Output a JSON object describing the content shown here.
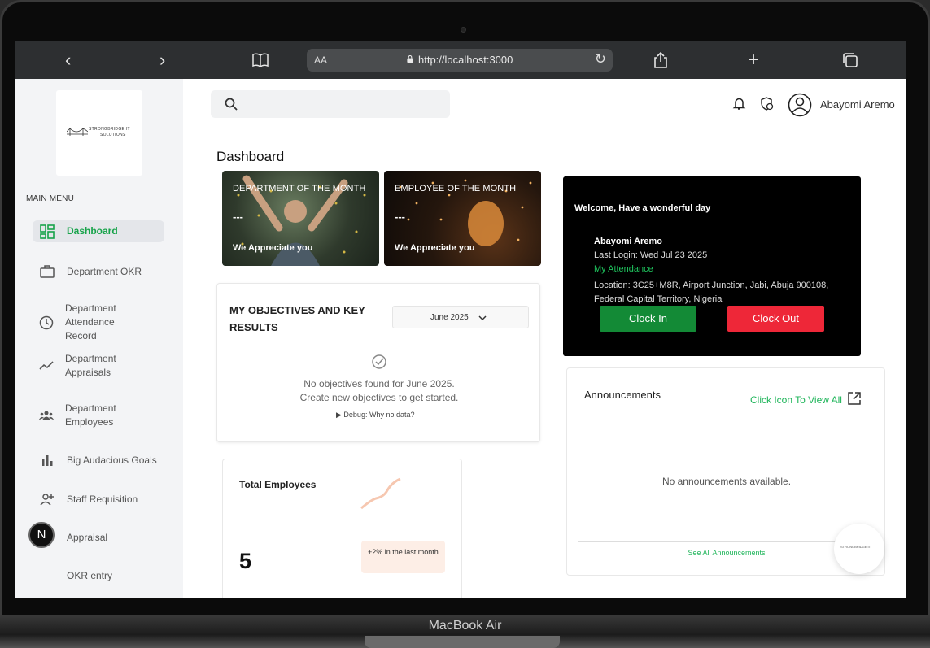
{
  "device": {
    "label": "MacBook Air"
  },
  "browser": {
    "url": "http://localhost:3000",
    "reader_label": "AA"
  },
  "sidebar": {
    "logo_text": "STRONGBRIDGE IT",
    "logo_subtext": "SOLUTIONS",
    "menu_title": "MAIN MENU",
    "items": [
      {
        "label": "Dashboard",
        "icon": "dashboard-icon",
        "active": true
      },
      {
        "label": "Department OKR",
        "icon": "briefcase-icon"
      },
      {
        "label": "Department Attendance Record",
        "icon": "clock-icon"
      },
      {
        "label": "Department Appraisals",
        "icon": "trend-icon"
      },
      {
        "label": "Department Employees",
        "icon": "group-icon"
      },
      {
        "label": "Big Audacious Goals",
        "icon": "bar-chart-icon"
      },
      {
        "label": "Staff Requisition",
        "icon": "person-add-icon"
      },
      {
        "label": "Appraisal",
        "icon": "target-icon"
      },
      {
        "label": "OKR entry",
        "icon": "n-badge-icon"
      }
    ],
    "badge_letter": "N"
  },
  "header": {
    "search_placeholder": "",
    "user_name": "Abayomi Aremo"
  },
  "page": {
    "title": "Dashboard"
  },
  "month_cards": [
    {
      "title": "DEPARTMENT OF THE MONTH",
      "value": "---",
      "subtitle": "We Appreciate you"
    },
    {
      "title": "EMPLOYEE OF THE MONTH",
      "value": "---",
      "subtitle": "We Appreciate you"
    }
  ],
  "objectives": {
    "title": "MY OBJECTIVES AND KEY RESULTS",
    "month_selected": "June 2025",
    "empty_line1": "No objectives found for June 2025.",
    "empty_line2": "Create new objectives to get started.",
    "debug_label": "Debug: Why no data?"
  },
  "employees": {
    "title": "Total Employees",
    "count": "5",
    "change_text": "+2% in the last month"
  },
  "welcome": {
    "greeting": "Welcome, Have a wonderful day",
    "name": "Abayomi Aremo",
    "last_login": "Last Login: Wed Jul 23 2025",
    "attendance_link": "My Attendance",
    "location": "Location: 3C25+M8R, Airport Junction, Jabi, Abuja 900108, Federal Capital Territory, Nigeria",
    "clock_in": "Clock In",
    "clock_out": "Clock Out"
  },
  "announcements": {
    "title": "Announcements",
    "view_all": "Click Icon To View All",
    "empty": "No announcements available.",
    "see_all": "See All Announcements"
  },
  "colors": {
    "accent_green": "#17a34a",
    "clock_in": "#138a36",
    "clock_out": "#ee2738",
    "browser_chrome": "#2d2f31"
  }
}
